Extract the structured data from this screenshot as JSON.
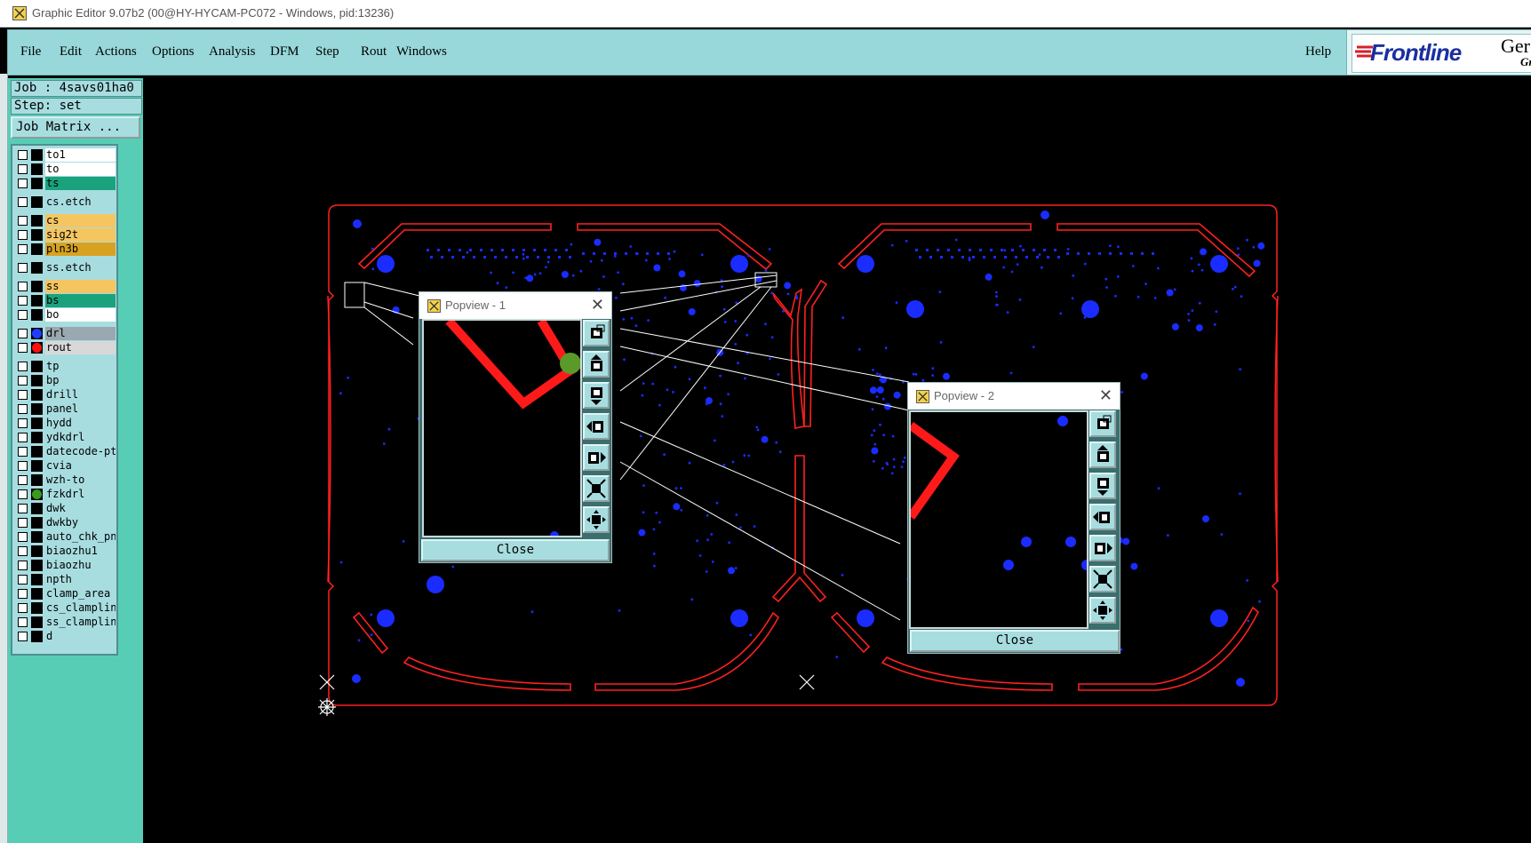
{
  "window": {
    "title": "Graphic Editor 9.07b2 (00@HY-HYCAM-PC072 - Windows, pid:13236)"
  },
  "menu": {
    "items": [
      "File",
      "Edit",
      "Actions",
      "Options",
      "Analysis",
      "DFM",
      "Step",
      "Rout",
      "Windows"
    ],
    "help": "Help"
  },
  "logo": {
    "brand": "Frontline",
    "product": "Ger",
    "product_sub": "Gr"
  },
  "job": {
    "job_label": "Job : 4savs01ha0",
    "step_label": "Step: set",
    "matrix_button": "Job Matrix ..."
  },
  "layers": [
    {
      "name": "to1",
      "bg": "#ffffff",
      "indicator": ""
    },
    {
      "name": "to",
      "bg": "#ffffff",
      "indicator": ""
    },
    {
      "name": "ts",
      "bg": "#1aa27c",
      "indicator": ""
    },
    {
      "name": "cs.etch",
      "bg": "#a8dde0",
      "indicator": ""
    },
    {
      "name": "cs",
      "bg": "#f5c560",
      "indicator": ""
    },
    {
      "name": "sig2t",
      "bg": "#f5c560",
      "indicator": ""
    },
    {
      "name": "pln3b",
      "bg": "#d8a220",
      "indicator": ""
    },
    {
      "name": "ss.etch",
      "bg": "#a8dde0",
      "indicator": ""
    },
    {
      "name": "ss",
      "bg": "#f5c560",
      "indicator": ""
    },
    {
      "name": "bs",
      "bg": "#1aa27c",
      "indicator": ""
    },
    {
      "name": "bo",
      "bg": "#ffffff",
      "indicator": ""
    },
    {
      "name": "drl",
      "bg": "#9aa8b0",
      "indicator": "#1f3cff"
    },
    {
      "name": "rout",
      "bg": "#d8d8d8",
      "indicator": "#ff1010"
    },
    {
      "name": "tp",
      "bg": "#a8dde0",
      "indicator": ""
    },
    {
      "name": "bp",
      "bg": "#a8dde0",
      "indicator": ""
    },
    {
      "name": "drill",
      "bg": "#a8dde0",
      "indicator": ""
    },
    {
      "name": "panel",
      "bg": "#a8dde0",
      "indicator": ""
    },
    {
      "name": "hydd",
      "bg": "#a8dde0",
      "indicator": ""
    },
    {
      "name": "ydkdrl",
      "bg": "#a8dde0",
      "indicator": ""
    },
    {
      "name": "datecode-pte",
      "bg": "#a8dde0",
      "indicator": ""
    },
    {
      "name": "cvia",
      "bg": "#a8dde0",
      "indicator": ""
    },
    {
      "name": "wzh-to",
      "bg": "#a8dde0",
      "indicator": ""
    },
    {
      "name": "fzkdrl",
      "bg": "#a8dde0",
      "indicator": "#3a9a20"
    },
    {
      "name": "dwk",
      "bg": "#a8dde0",
      "indicator": ""
    },
    {
      "name": "dwkby",
      "bg": "#a8dde0",
      "indicator": ""
    },
    {
      "name": "auto_chk_pnl",
      "bg": "#a8dde0",
      "indicator": ""
    },
    {
      "name": "biaozhu1",
      "bg": "#a8dde0",
      "indicator": ""
    },
    {
      "name": "biaozhu",
      "bg": "#a8dde0",
      "indicator": ""
    },
    {
      "name": "npth",
      "bg": "#a8dde0",
      "indicator": ""
    },
    {
      "name": "clamp_area",
      "bg": "#a8dde0",
      "indicator": ""
    },
    {
      "name": "cs_clampline",
      "bg": "#a8dde0",
      "indicator": ""
    },
    {
      "name": "ss_clampline",
      "bg": "#a8dde0",
      "indicator": ""
    },
    {
      "name": "d",
      "bg": "#a8dde0",
      "indicator": ""
    }
  ],
  "popview1": {
    "title": "Popview - 1",
    "close_label": "Close"
  },
  "popview2": {
    "title": "Popview - 2",
    "close_label": "Close"
  },
  "colors": {
    "rout": "#ff1a1a",
    "drill": "#1a2cff",
    "accent": "#98d8da",
    "sidebar": "#58cdb6"
  }
}
